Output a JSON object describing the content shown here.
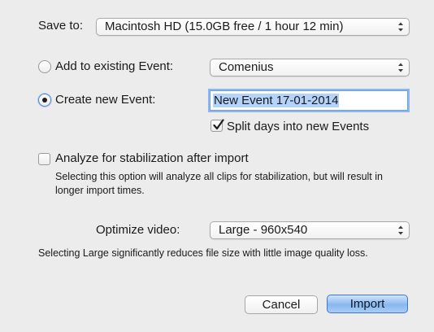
{
  "save_to": {
    "label": "Save to:",
    "value": "Macintosh HD (15.0GB free / 1 hour 12 min)"
  },
  "existing_event": {
    "label": "Add to existing Event:",
    "value": "Comenius",
    "selected": false
  },
  "new_event": {
    "label": "Create new Event:",
    "value": "New Event 17-01-2014",
    "selected": true
  },
  "split_days": {
    "label": "Split days into new Events",
    "checked": true
  },
  "stabilization": {
    "label": "Analyze for stabilization after import",
    "checked": false,
    "description": "Selecting this option will analyze all clips for stabilization, but will result in longer import times."
  },
  "optimize": {
    "label": "Optimize video:",
    "value": "Large - 960x540",
    "description": "Selecting Large significantly reduces file size with little image quality loss."
  },
  "buttons": {
    "cancel": "Cancel",
    "import": "Import"
  },
  "colors": {
    "window_bg": "#ececec",
    "focus_ring": "#8ab8f2",
    "default_button": "#88b8ee",
    "checkmark": "#1e1e1e"
  },
  "icons": {
    "popup_arrows": "up-down-arrows-icon",
    "check": "checkmark-icon"
  }
}
